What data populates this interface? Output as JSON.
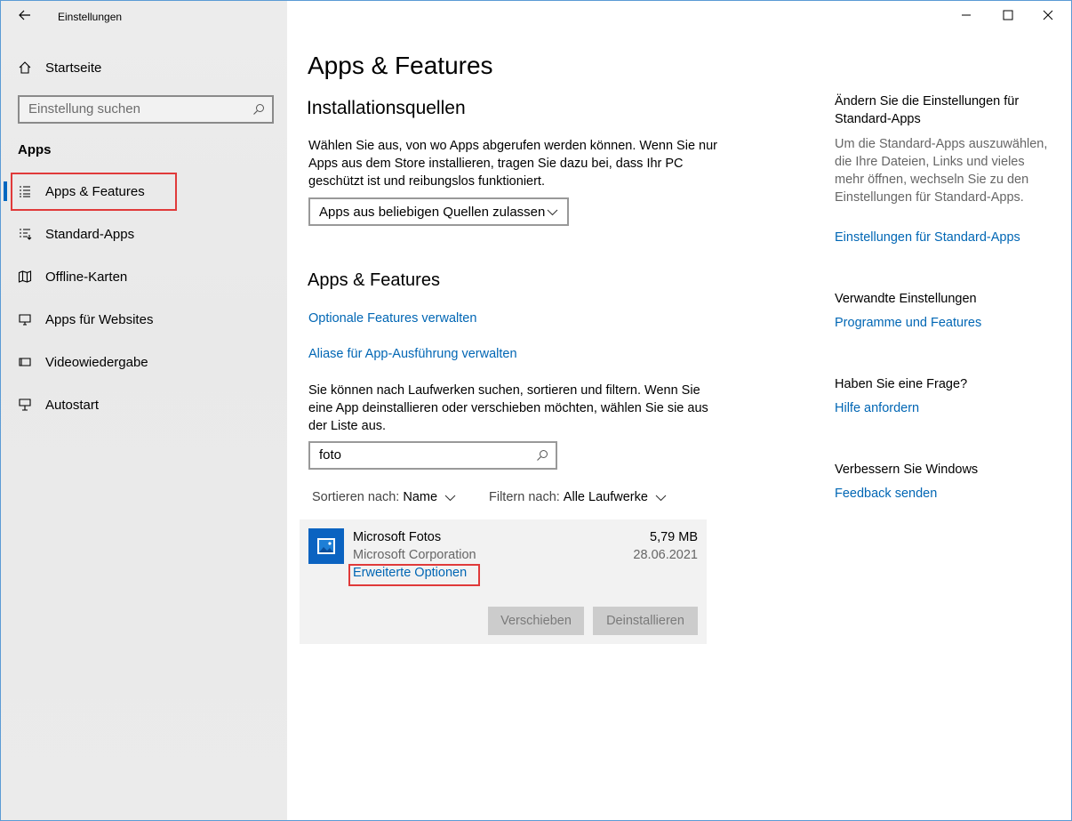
{
  "window": {
    "title": "Einstellungen",
    "controls": [
      "minimize-icon",
      "maximize-icon",
      "close-icon"
    ]
  },
  "sidebar": {
    "home_label": "Startseite",
    "search_placeholder": "Einstellung suchen",
    "section": "Apps",
    "items": [
      {
        "label": "Apps & Features",
        "icon": "apps-features-icon",
        "active": true
      },
      {
        "label": "Standard-Apps",
        "icon": "default-apps-icon"
      },
      {
        "label": "Offline-Karten",
        "icon": "map-icon"
      },
      {
        "label": "Apps für Websites",
        "icon": "apps-websites-icon"
      },
      {
        "label": "Videowiedergabe",
        "icon": "video-icon"
      },
      {
        "label": "Autostart",
        "icon": "startup-icon"
      }
    ]
  },
  "main": {
    "title": "Apps & Features",
    "install_sources": {
      "heading": "Installationsquellen",
      "description": "Wählen Sie aus, von wo Apps abgerufen werden können. Wenn Sie nur Apps aus dem Store installieren, tragen Sie dazu bei, dass Ihr PC geschützt ist und reibungslos funktioniert.",
      "dropdown_value": "Apps aus beliebigen Quellen zulassen"
    },
    "apps_section": {
      "heading": "Apps & Features",
      "link_optional": "Optionale Features verwalten",
      "link_aliases": "Aliase für App-Ausführung verwalten",
      "description": "Sie können nach Laufwerken suchen, sortieren und filtern. Wenn Sie eine App deinstallieren oder verschieben möchten, wählen Sie sie aus der Liste aus.",
      "search_value": "foto",
      "sort_label": "Sortieren nach:",
      "sort_value": "Name",
      "filter_label": "Filtern nach:",
      "filter_value": "Alle Laufwerke"
    },
    "app": {
      "name": "Microsoft Fotos",
      "publisher": "Microsoft Corporation",
      "size": "5,79 MB",
      "date": "28.06.2021",
      "advanced_link": "Erweiterte Optionen",
      "move_button": "Verschieben",
      "uninstall_button": "Deinstallieren"
    }
  },
  "right": {
    "default_apps_heading": "Ändern Sie die Einstellungen für Standard-Apps",
    "default_apps_text": "Um die Standard-Apps auszuwählen, die Ihre Dateien, Links und vieles mehr öffnen, wechseln Sie zu den Einstellungen für Standard-Apps.",
    "default_apps_link": "Einstellungen für Standard-Apps",
    "related_heading": "Verwandte Einstellungen",
    "related_link": "Programme und Features",
    "question_heading": "Haben Sie eine Frage?",
    "question_link": "Hilfe anfordern",
    "improve_heading": "Verbessern Sie Windows",
    "improve_link": "Feedback senden"
  },
  "colors": {
    "accent": "#0067c0",
    "link": "#0066b4",
    "highlight_box": "#e03a3a"
  }
}
